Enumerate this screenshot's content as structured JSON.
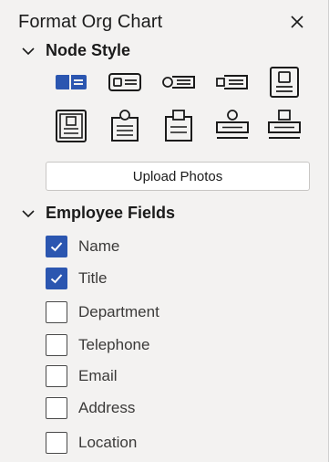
{
  "pane": {
    "title": "Format Org Chart",
    "close_icon": "close-icon"
  },
  "node_style": {
    "heading": "Node Style",
    "styles": [
      {
        "name": "style-side-bar",
        "selected": true
      },
      {
        "name": "style-card-lines"
      },
      {
        "name": "style-tag-lines"
      },
      {
        "name": "style-tab-lines"
      },
      {
        "name": "style-portrait-card"
      },
      {
        "name": "style-framed-lines"
      },
      {
        "name": "style-badge-circle"
      },
      {
        "name": "style-badge-tab"
      },
      {
        "name": "style-circle-stack"
      },
      {
        "name": "style-square-stack"
      }
    ],
    "upload_label": "Upload Photos"
  },
  "employee_fields": {
    "heading": "Employee Fields",
    "items": [
      {
        "label": "Name",
        "checked": true
      },
      {
        "label": "Title",
        "checked": true
      },
      {
        "label": "Department",
        "checked": false
      },
      {
        "label": "Telephone",
        "checked": false
      },
      {
        "label": "Email",
        "checked": false
      },
      {
        "label": "Address",
        "checked": false
      },
      {
        "label": "Location",
        "checked": false
      }
    ]
  },
  "colors": {
    "accent": "#2b56b0",
    "background": "#f3f2f1",
    "icon_stroke": "#1b1b1b"
  }
}
